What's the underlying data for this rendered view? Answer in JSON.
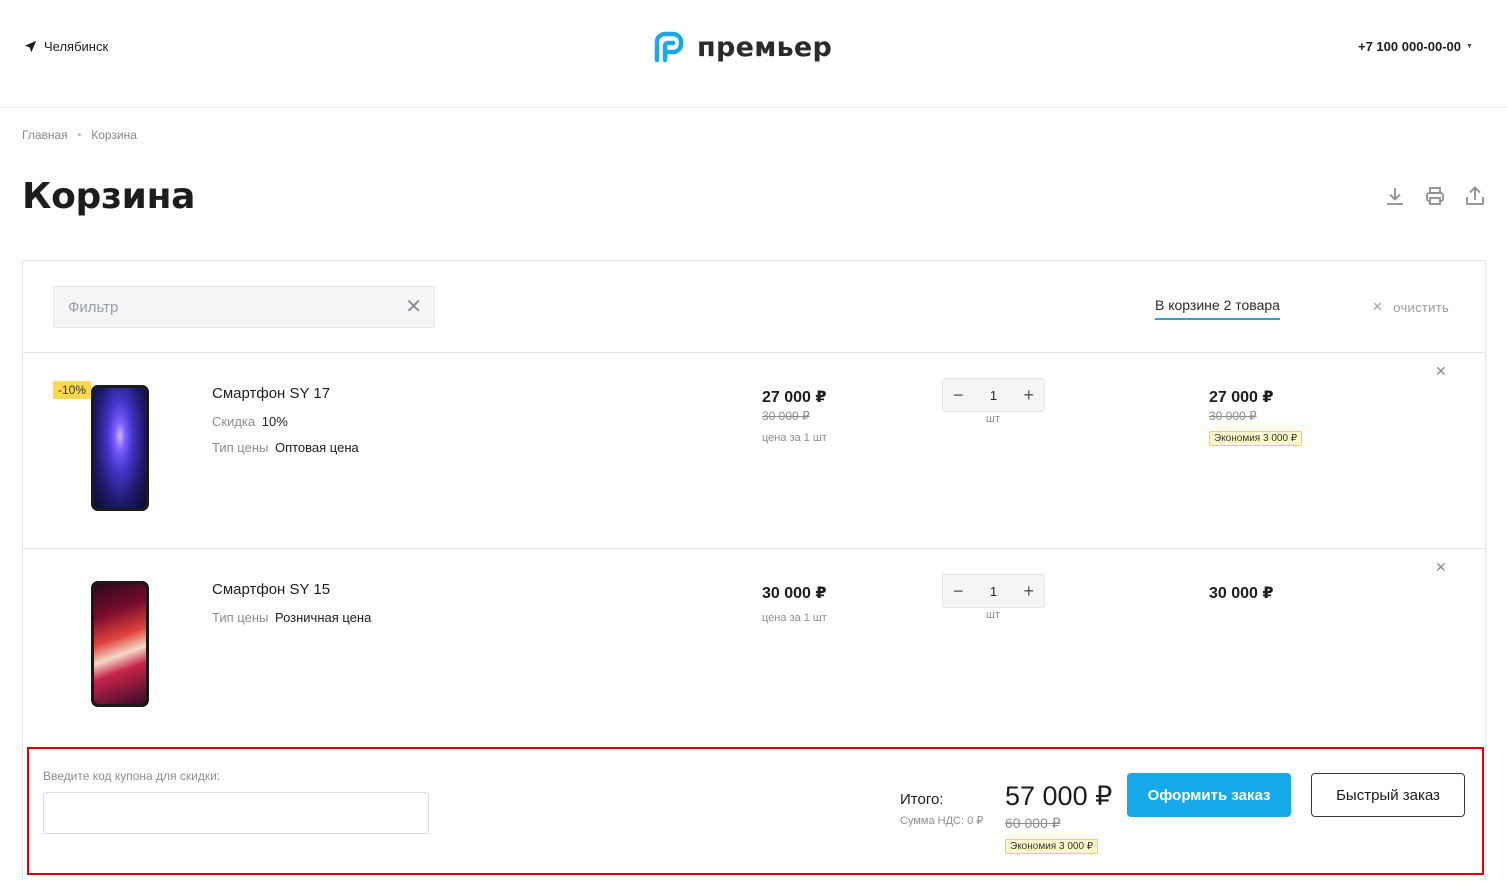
{
  "header": {
    "city": "Челябинск",
    "logo_text": "премьер",
    "phone": "+7 100 000-00-00",
    "brand_color": "#1aa9e6"
  },
  "breadcrumb": [
    "Главная",
    "Корзина"
  ],
  "page_title": "Корзина",
  "tools": {
    "download": "download-icon",
    "print": "print-icon",
    "share": "share-icon"
  },
  "cart": {
    "filter_placeholder": "Фильтр",
    "count_label": "В корзине 2 товара",
    "clear_label": "очистить",
    "items": [
      {
        "badge": "-10%",
        "name": "Смартфон SY 17",
        "discount_label": "Скидка",
        "discount_value": "10%",
        "price_type_label": "Тип цены",
        "price_type_value": "Оптовая цена",
        "price": "27 000 ₽",
        "old_price": "30 000 ₽",
        "per_unit": "цена за 1 шт",
        "qty": "1",
        "unit": "шт",
        "sum": "27 000 ₽",
        "sum_old": "30 000 ₽",
        "saving": "Экономия  3 000 ₽"
      },
      {
        "name": "Смартфон SY 15",
        "price_type_label": "Тип цены",
        "price_type_value": "Розничная цена",
        "price": "30 000 ₽",
        "per_unit": "цена за 1 шт",
        "qty": "1",
        "unit": "шт",
        "sum": "30 000 ₽"
      }
    ]
  },
  "footer": {
    "coupon_label": "Введите код купона для скидки:",
    "total_label": "Итого:",
    "vat_label": "Сумма НДС: 0 ₽",
    "total": "57 000 ₽",
    "total_old": "60 000 ₽",
    "total_saving": "Экономия  3 000 ₽",
    "order_button": "Оформить заказ",
    "quick_button": "Быстрый заказ"
  }
}
